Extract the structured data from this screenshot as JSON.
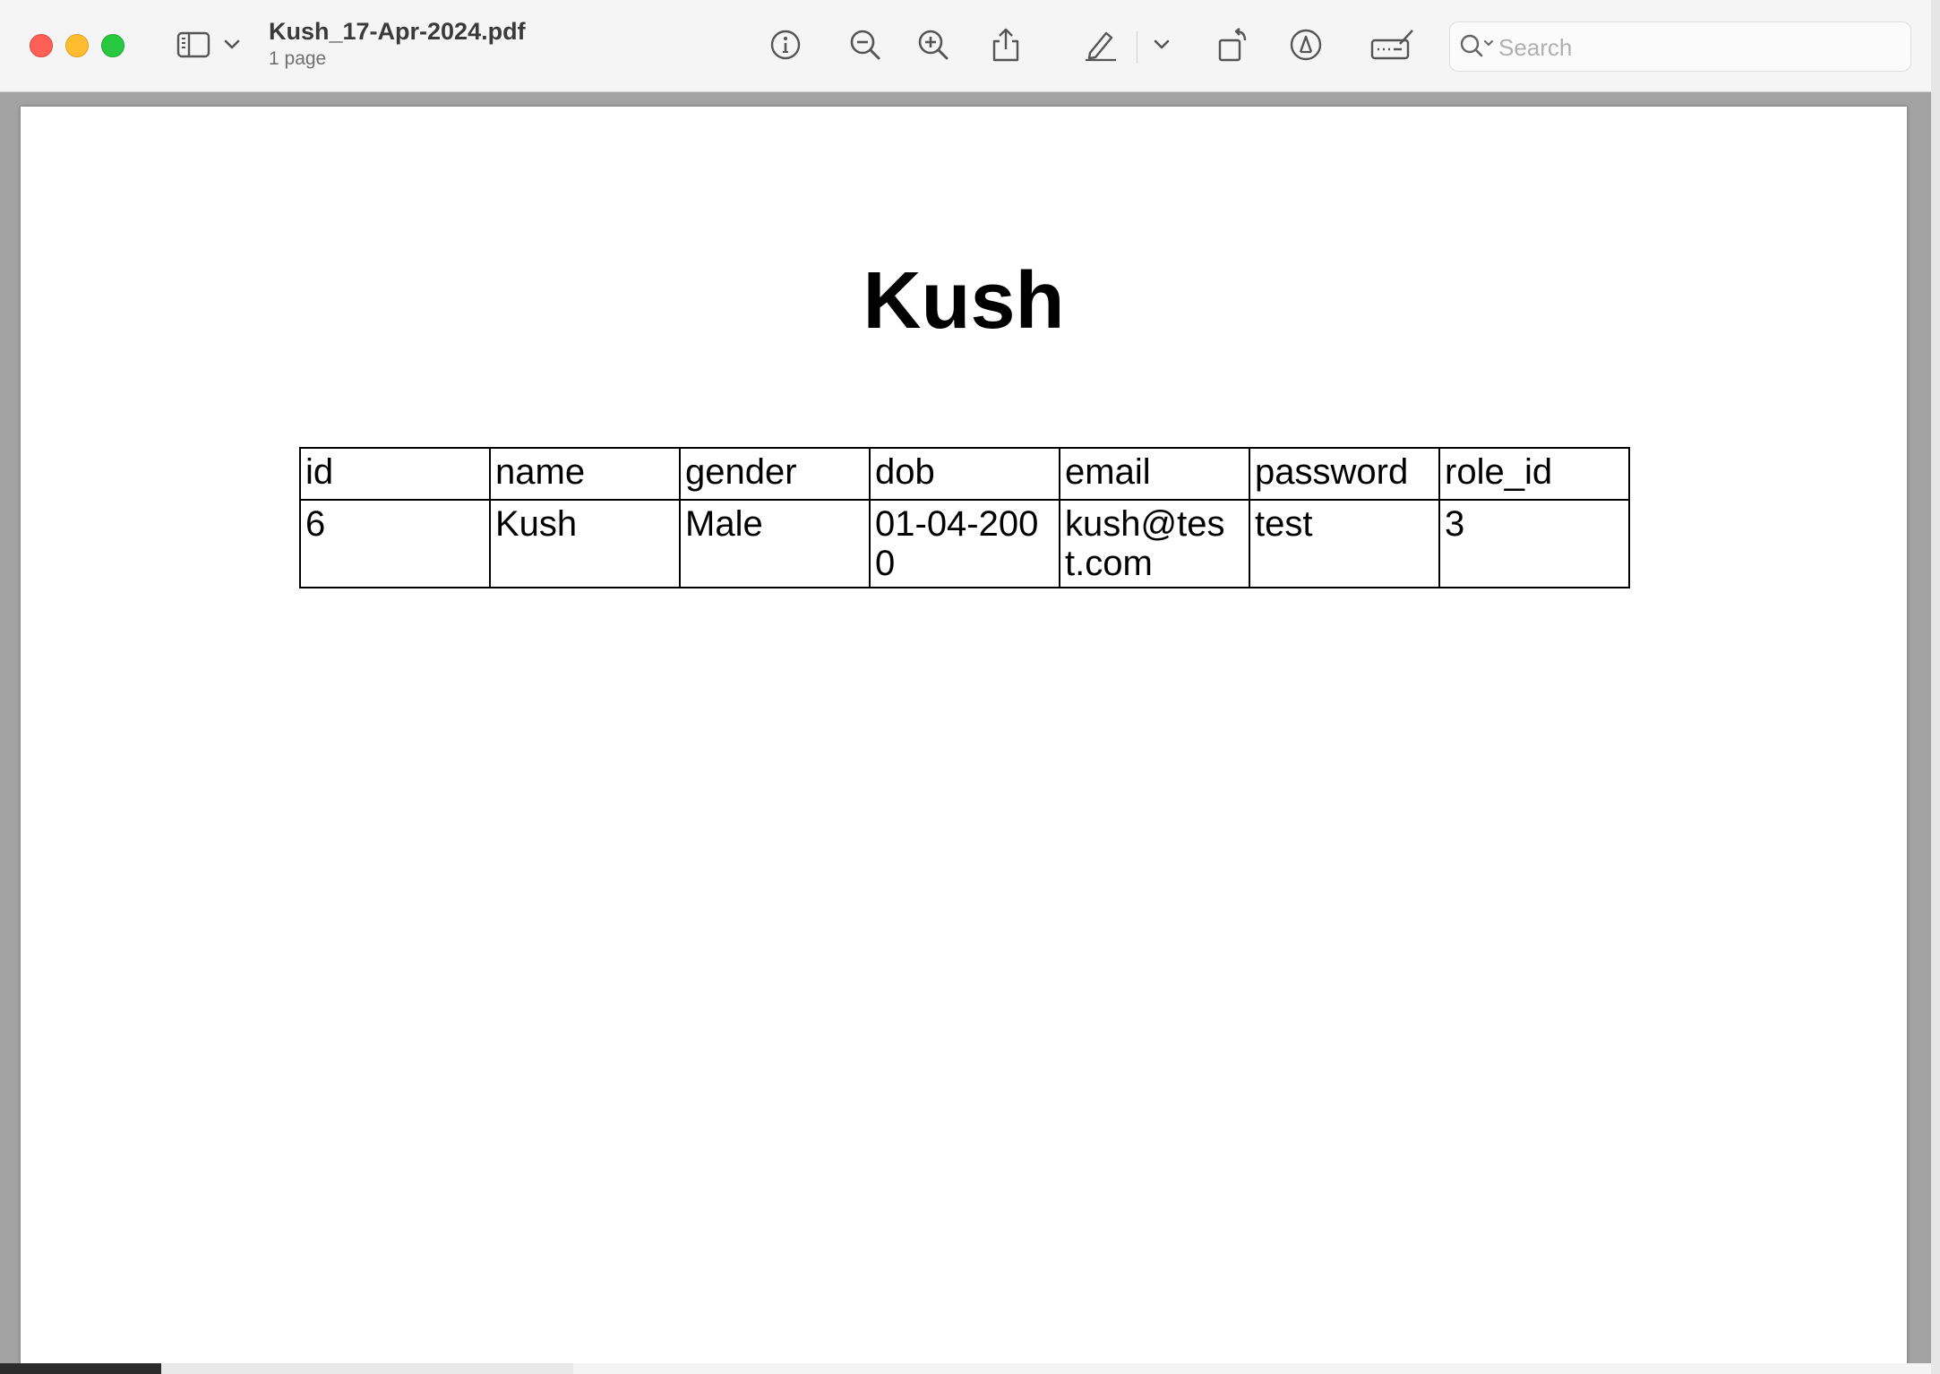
{
  "window": {
    "title": "Kush_17-Apr-2024.pdf",
    "subtitle": "1 page"
  },
  "toolbar": {
    "icons": [
      "sidebar-icon",
      "chevron-down-icon",
      "info-icon",
      "zoom-out-icon",
      "zoom-in-icon",
      "share-icon",
      "highlight-icon",
      "chevron-down-icon",
      "rotate-icon",
      "markup-icon",
      "form-icon"
    ],
    "search_placeholder": "Search"
  },
  "document": {
    "title": "Kush",
    "table": {
      "headers": [
        "id",
        "name",
        "gender",
        "dob",
        "email",
        "password",
        "role_id"
      ],
      "rows": [
        [
          "6",
          "Kush",
          "Male",
          "01-04-2000",
          "kush@test.com",
          "test",
          "3"
        ]
      ]
    }
  },
  "colors": {
    "close": "#fe5f57",
    "minimize": "#febc2e",
    "zoom": "#28c840",
    "toolbar_bg": "#f5f5f5",
    "window_bg": "#a3a3a3"
  }
}
